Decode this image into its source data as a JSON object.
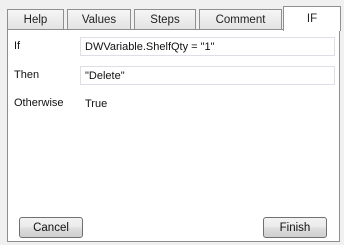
{
  "tabs": [
    {
      "label": "Help"
    },
    {
      "label": "Values"
    },
    {
      "label": "Steps"
    },
    {
      "label": "Comment"
    },
    {
      "label": "IF",
      "active": true
    }
  ],
  "rows": [
    {
      "label": "If",
      "value": "DWVariable.ShelfQty = \"1\""
    },
    {
      "label": "Then",
      "value": "\"Delete\""
    },
    {
      "label": "Otherwise",
      "value": "True"
    }
  ],
  "buttons": {
    "cancel": "Cancel",
    "finish": "Finish"
  }
}
